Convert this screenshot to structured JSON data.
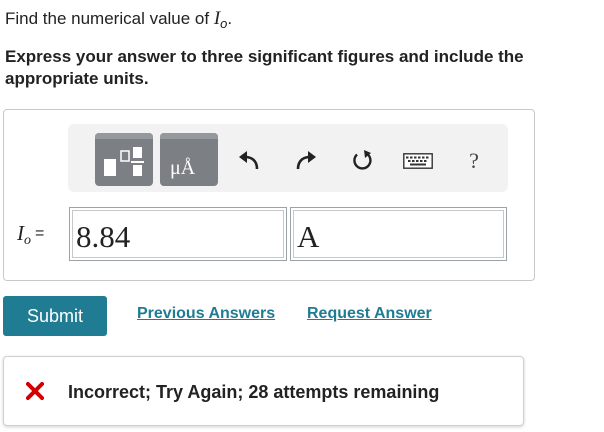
{
  "question": {
    "prefix": "Find the numerical value of ",
    "variable": "I",
    "subscript": "o",
    "suffix": ".",
    "instructions": "Express your answer to three significant figures and include the appropriate units."
  },
  "toolbar": {
    "template_button_icon": "templates-icon",
    "units_button_icon": "units-icon",
    "units_glyph": "μÅ",
    "undo_icon": "undo-icon",
    "redo_icon": "redo-icon",
    "reset_icon": "reset-icon",
    "keyboard_icon": "keyboard-icon",
    "help_label": "?"
  },
  "answer": {
    "label_var": "I",
    "label_sub": "o",
    "label_eq": "=",
    "value": "8.84",
    "unit": "A"
  },
  "actions": {
    "submit_label": "Submit",
    "previous_answers_label": "Previous Answers",
    "request_answer_label": "Request Answer"
  },
  "feedback": {
    "icon": "x-icon",
    "text": "Incorrect; Try Again; 28 attempts remaining",
    "icon_color": "#d40000"
  },
  "colors": {
    "accent": "#1f7c92",
    "toolbar_button": "#7c7f84"
  }
}
